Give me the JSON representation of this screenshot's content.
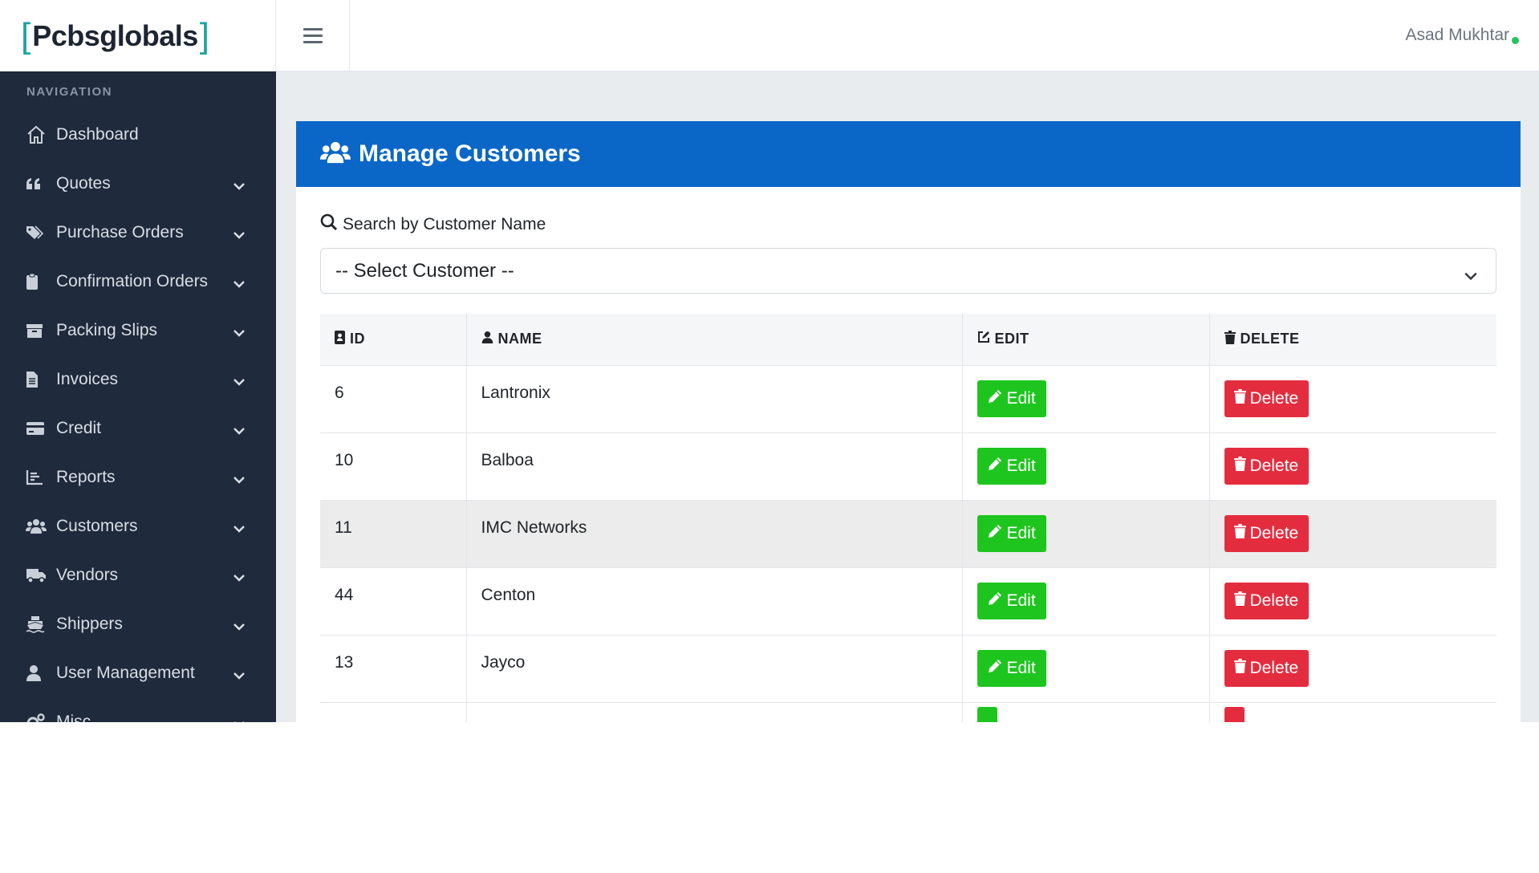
{
  "brand": {
    "open_bracket": "[",
    "name": "Pcbsglobals",
    "close_bracket": "]"
  },
  "header": {
    "user_name": "Asad Mukhtar",
    "status_color": "#22c55e"
  },
  "sidebar": {
    "section_title": "NAVIGATION",
    "items": [
      {
        "label": "Dashboard",
        "icon": "home-icon"
      },
      {
        "label": "Quotes",
        "icon": "quote-icon"
      },
      {
        "label": "Purchase Orders",
        "icon": "tags-icon"
      },
      {
        "label": "Confirmation Orders",
        "icon": "clipboard-icon"
      },
      {
        "label": "Packing Slips",
        "icon": "archive-icon"
      },
      {
        "label": "Invoices",
        "icon": "file-icon"
      },
      {
        "label": "Credit",
        "icon": "credit-card-icon"
      },
      {
        "label": "Reports",
        "icon": "chart-icon"
      },
      {
        "label": "Customers",
        "icon": "users-icon"
      },
      {
        "label": "Vendors",
        "icon": "truck-icon"
      },
      {
        "label": "Shippers",
        "icon": "ship-icon"
      },
      {
        "label": "User Management",
        "icon": "user-icon"
      },
      {
        "label": "Misc",
        "icon": "cogs-icon"
      }
    ]
  },
  "page": {
    "title": "Manage Customers",
    "search_label": "Search by Customer Name",
    "select_value": "-- Select Customer --"
  },
  "table": {
    "headers": {
      "id": "ID",
      "name": "NAME",
      "edit": "EDIT",
      "delete": "DELETE"
    },
    "edit_label": "Edit",
    "delete_label": "Delete",
    "rows": [
      {
        "id": "6",
        "name": "Lantronix"
      },
      {
        "id": "10",
        "name": "Balboa"
      },
      {
        "id": "11",
        "name": "IMC Networks"
      },
      {
        "id": "44",
        "name": "Centon"
      },
      {
        "id": "13",
        "name": "Jayco"
      }
    ]
  },
  "colors": {
    "header_blue": "#0b67c7",
    "sidebar_bg": "#1f2a3c",
    "edit_green": "#1ec51e",
    "delete_red": "#e32d3f",
    "brand_accent": "#1aa6a0"
  }
}
